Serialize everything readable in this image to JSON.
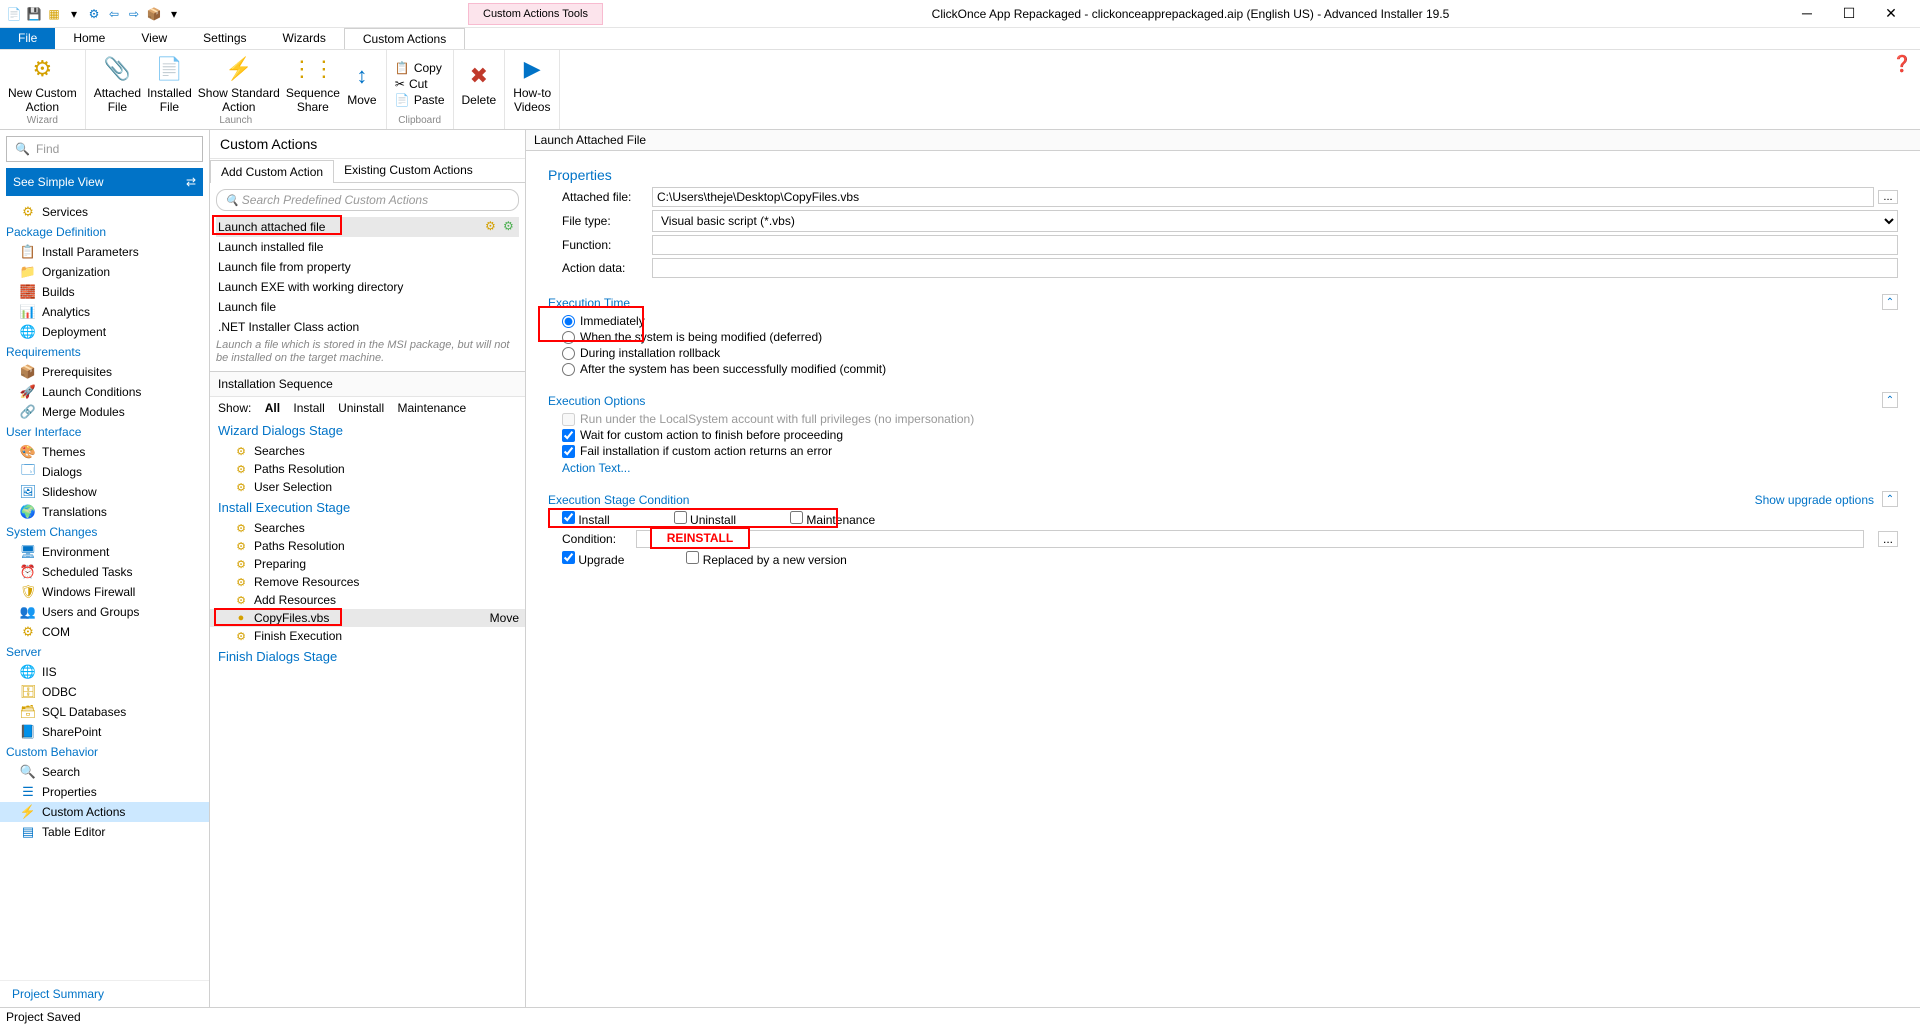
{
  "titlebar": {
    "tool_tab": "Custom Actions Tools",
    "title": "ClickOnce App Repackaged - clickonceapprepackaged.aip (English US) - Advanced Installer 19.5"
  },
  "tabs": {
    "file": "File",
    "home": "Home",
    "view": "View",
    "settings": "Settings",
    "wizards": "Wizards",
    "custom": "Custom Actions"
  },
  "ribbon": {
    "wizard": {
      "new": "New Custom\nAction",
      "label": "Wizard"
    },
    "launch": {
      "attached": "Attached\nFile",
      "installed": "Installed\nFile",
      "showstd": "Show Standard\nAction",
      "seq": "Sequence\nShare",
      "move": "Move",
      "label": "Launch"
    },
    "delete": "Delete",
    "clipboard": {
      "copy": "Copy",
      "cut": "Cut",
      "paste": "Paste",
      "label": "Clipboard"
    },
    "howto": "How-to\nVideos"
  },
  "find_placeholder": "Find",
  "simple_view": "See Simple View",
  "nav": {
    "services": "Services",
    "pkgdef": "Package Definition",
    "install_params": "Install Parameters",
    "organization": "Organization",
    "builds": "Builds",
    "analytics": "Analytics",
    "deployment": "Deployment",
    "requirements": "Requirements",
    "prereq": "Prerequisites",
    "launchcond": "Launch Conditions",
    "merge": "Merge Modules",
    "ui": "User Interface",
    "themes": "Themes",
    "dialogs": "Dialogs",
    "slideshow": "Slideshow",
    "translations": "Translations",
    "syschanges": "System Changes",
    "env": "Environment",
    "sched": "Scheduled Tasks",
    "firewall": "Windows Firewall",
    "users": "Users and Groups",
    "com": "COM",
    "server": "Server",
    "iis": "IIS",
    "odbc": "ODBC",
    "sql": "SQL Databases",
    "sharepoint": "SharePoint",
    "custombeh": "Custom Behavior",
    "search": "Search",
    "properties": "Properties",
    "customactions": "Custom Actions",
    "tableedit": "Table Editor",
    "projsum": "Project Summary"
  },
  "mid": {
    "title": "Custom Actions",
    "tab_add": "Add Custom Action",
    "tab_existing": "Existing Custom Actions",
    "search_ph": "Search Predefined Custom Actions",
    "ca": {
      "attached": "Launch attached file",
      "installed": "Launch installed file",
      "fromprop": "Launch file from property",
      "exewd": "Launch EXE with working directory",
      "launchfile": "Launch file",
      "netclass": ".NET Installer Class action"
    },
    "hint": "Launch a file which is stored in the MSI package, but will not be installed on the target machine.",
    "seq_title": "Installation Sequence",
    "show": "Show:",
    "all": "All",
    "install": "Install",
    "uninstall": "Uninstall",
    "maint": "Maintenance",
    "wizstage": "Wizard Dialogs Stage",
    "searches": "Searches",
    "pathsres": "Paths Resolution",
    "usersel": "User Selection",
    "instexec": "Install Execution Stage",
    "preparing": "Preparing",
    "removeres": "Remove Resources",
    "addres": "Add Resources",
    "copyfiles": "CopyFiles.vbs",
    "move": "Move",
    "finishexec": "Finish Execution",
    "finstage": "Finish Dialogs Stage"
  },
  "detail": {
    "title": "Launch Attached File",
    "props": "Properties",
    "attached_lbl": "Attached file:",
    "attached_val": "C:\\Users\\theje\\Desktop\\CopyFiles.vbs",
    "filetype_lbl": "File type:",
    "filetype_val": "Visual basic script (*.vbs)",
    "function_lbl": "Function:",
    "function_val": "",
    "actiondata_lbl": "Action data:",
    "actiondata_val": "",
    "exectime": "Execution Time",
    "immediately": "Immediately",
    "deferred": "When the system is being modified (deferred)",
    "rollback": "During installation rollback",
    "commit": "After the system has been successfully modified (commit)",
    "execopts": "Execution Options",
    "runlocal": "Run under the LocalSystem account with full privileges (no impersonation)",
    "wait": "Wait for custom action to finish before proceeding",
    "fail": "Fail installation if custom action returns an error",
    "actiontext": "Action Text...",
    "execstage": "Execution Stage Condition",
    "install": "Install",
    "uninstall": "Uninstall",
    "maint": "Maintenance",
    "showupgrade": "Show upgrade options",
    "condition_lbl": "Condition:",
    "reinstall": "REINSTALL",
    "upgrade": "Upgrade",
    "replaced": "Replaced by a new version"
  },
  "status": "Project Saved"
}
